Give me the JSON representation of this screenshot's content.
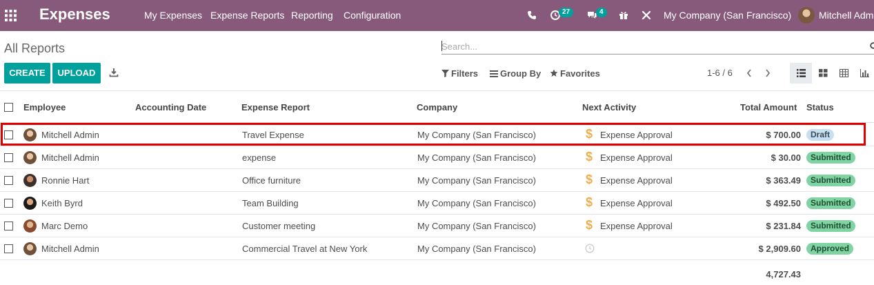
{
  "app": {
    "title": "Expenses"
  },
  "menu": [
    "My Expenses",
    "Expense Reports",
    "Reporting",
    "Configuration"
  ],
  "systray": {
    "activity_count": "27",
    "message_count": "4",
    "company": "My Company (San Francisco)",
    "user": "Mitchell Admin"
  },
  "breadcrumb": "All Reports",
  "search": {
    "placeholder": "Search..."
  },
  "buttons": {
    "create": "CREATE",
    "upload": "UPLOAD"
  },
  "filters": {
    "filters": "Filters",
    "group_by": "Group By",
    "favorites": "Favorites"
  },
  "pager": "1-6 / 6",
  "columns": {
    "employee": "Employee",
    "accounting_date": "Accounting Date",
    "expense_report": "Expense Report",
    "company": "Company",
    "next_activity": "Next Activity",
    "total_amount": "Total Amount",
    "status": "Status"
  },
  "rows": [
    {
      "employee": "Mitchell Admin",
      "accounting_date": "",
      "report": "Travel Expense",
      "company": "My Company (San Francisco)",
      "activity": "Expense Approval",
      "amount": "$ 700.00",
      "status": "Draft"
    },
    {
      "employee": "Mitchell Admin",
      "accounting_date": "",
      "report": "expense",
      "company": "My Company (San Francisco)",
      "activity": "Expense Approval",
      "amount": "$ 30.00",
      "status": "Submitted"
    },
    {
      "employee": "Ronnie Hart",
      "accounting_date": "",
      "report": "Office furniture",
      "company": "My Company (San Francisco)",
      "activity": "Expense Approval",
      "amount": "$ 363.49",
      "status": "Submitted"
    },
    {
      "employee": "Keith Byrd",
      "accounting_date": "",
      "report": "Team Building",
      "company": "My Company (San Francisco)",
      "activity": "Expense Approval",
      "amount": "$ 492.50",
      "status": "Submitted"
    },
    {
      "employee": "Marc Demo",
      "accounting_date": "",
      "report": "Customer meeting",
      "company": "My Company (San Francisco)",
      "activity": "Expense Approval",
      "amount": "$ 231.84",
      "status": "Submitted"
    },
    {
      "employee": "Mitchell Admin",
      "accounting_date": "",
      "report": "Commercial Travel at New York",
      "company": "My Company (San Francisco)",
      "activity": "",
      "amount": "$ 2,909.60",
      "status": "Approved"
    }
  ],
  "total": "4,727.43",
  "colors": {
    "navbar": "#875a7b",
    "primary": "#00a09d",
    "highlight": "#e00000"
  }
}
